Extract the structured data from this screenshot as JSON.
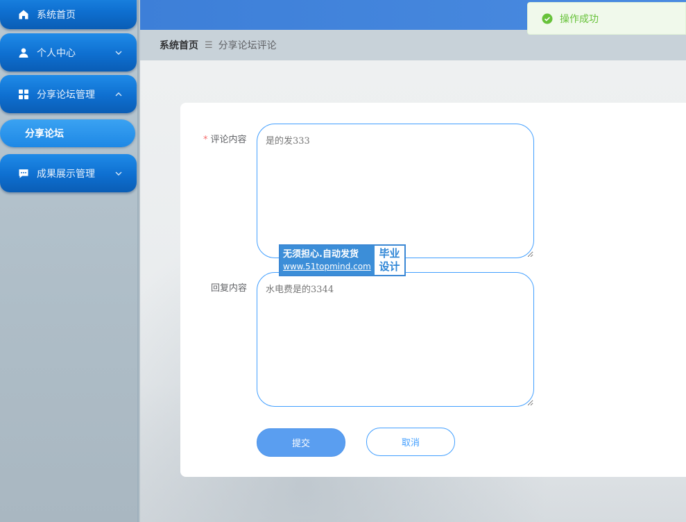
{
  "sidebar": {
    "items": [
      {
        "label": "系统首页",
        "icon": "home-icon"
      },
      {
        "label": "个人中心",
        "icon": "user-icon",
        "expanded": false
      },
      {
        "label": "分享论坛管理",
        "icon": "grid-icon",
        "expanded": true,
        "children": [
          {
            "label": "分享论坛",
            "active": true
          }
        ]
      },
      {
        "label": "成果展示管理",
        "icon": "message-icon",
        "expanded": false
      }
    ]
  },
  "toast": {
    "message": "操作成功",
    "icon": "check-circle-icon",
    "color": "#67c23a"
  },
  "breadcrumb": {
    "home": "系统首页",
    "separator": "☰",
    "current": "分享论坛评论"
  },
  "form": {
    "comment": {
      "label": "评论内容",
      "required": true,
      "placeholder": "是的发333"
    },
    "reply": {
      "label": "回复内容",
      "required": false,
      "placeholder": "水电费是的3344"
    },
    "submit_label": "提交",
    "cancel_label": "取消"
  },
  "watermark": {
    "line1": "无须担心.自动发货",
    "line2": "www.51topmind.com",
    "side1": "毕业",
    "side2": "设计"
  },
  "colors": {
    "accent": "#409eff",
    "sidebar_item": "#0e6fd0",
    "topbar": "#3d7fd8"
  }
}
